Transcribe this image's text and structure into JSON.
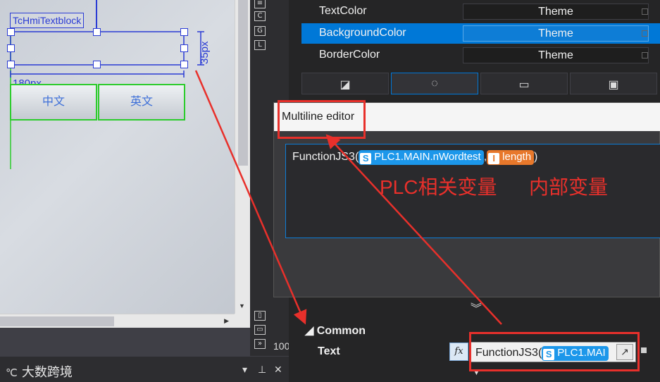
{
  "designer": {
    "control_label": "TcHmiTextblock",
    "width_label": "180px",
    "height_label": "35px",
    "buttons": [
      "中文",
      "英文"
    ],
    "zoom": "100"
  },
  "vertical_toolbar": {
    "icons": [
      "list-icon",
      "c-icon",
      "g-icon",
      "l-icon",
      "layout-icon-1",
      "layout-icon-2",
      "expand-icon"
    ],
    "letters": [
      "C",
      "G",
      "L"
    ]
  },
  "properties": {
    "rows": [
      {
        "name": "TextColor",
        "value": "Theme"
      },
      {
        "name": "BackgroundColor",
        "value": "Theme"
      },
      {
        "name": "BorderColor",
        "value": "Theme"
      }
    ],
    "selected_index": 1,
    "icon_tabs": [
      "no-fill-icon",
      "gradient-circle-icon",
      "solid-fill-icon",
      "image-fill-icon"
    ]
  },
  "multiline_editor": {
    "title": "Multiline editor",
    "prefix": "FunctionJS3(",
    "token_symbol": {
      "badge": "S",
      "text": "PLC1.MAIN.nWordtest"
    },
    "separator": ",",
    "token_internal": {
      "badge": "I",
      "text": "length"
    },
    "suffix": ")",
    "annotation_plc": "PLC相关变量",
    "annotation_internal": "内部变量"
  },
  "common": {
    "header": "Common",
    "text_label": "Text",
    "fx_label": "fx",
    "value_prefix": "FunctionJS3(",
    "value_token_badge": "S",
    "value_token_text": "PLC1.MAI"
  },
  "branding": {
    "name": "大数跨境",
    "logo": "℃"
  },
  "colors": {
    "accent": "#0078d7",
    "highlight": "#e8302b",
    "symbol_token": "#1c97ea",
    "internal_token": "#e8782b"
  }
}
